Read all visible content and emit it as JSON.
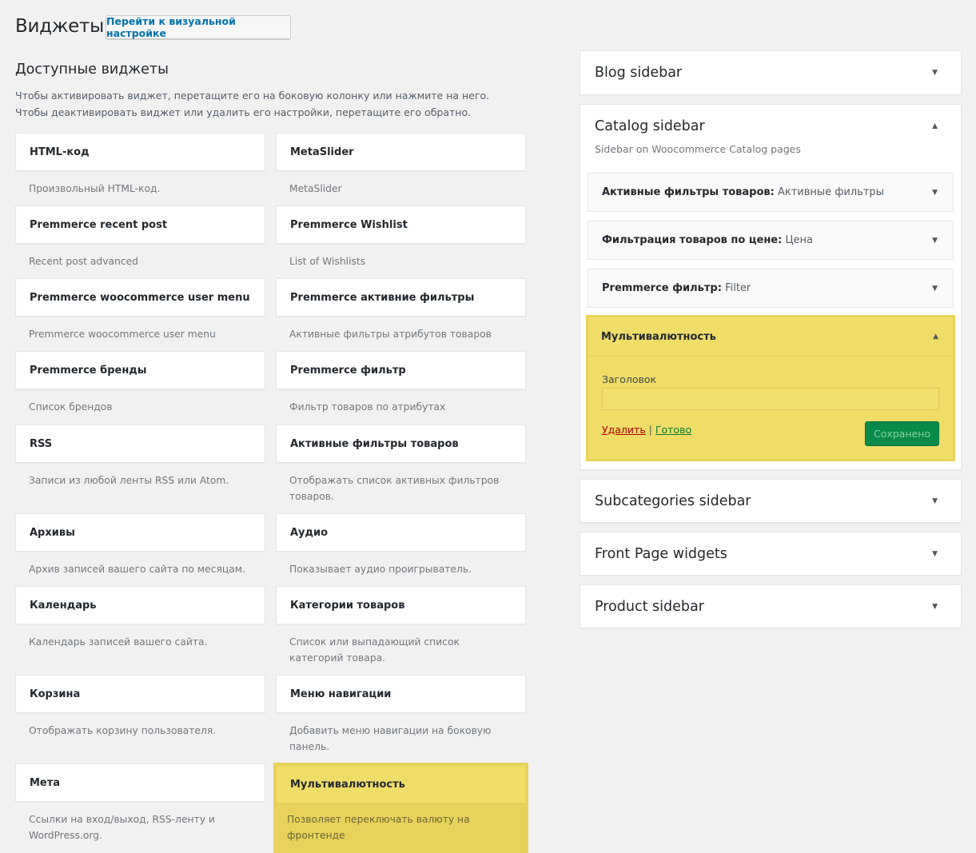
{
  "header": {
    "title": "Виджеты",
    "customize_label": "Перейти к визуальной настройке"
  },
  "available": {
    "title": "Доступные виджеты",
    "description": "Чтобы активировать виджет, перетащите его на боковую колонку или нажмите на него. Чтобы деактивировать виджет или удалить его настройки, перетащите его обратно.",
    "widgets": [
      {
        "title": "HTML-код",
        "desc": "Произвольный HTML-код."
      },
      {
        "title": "MetaSlider",
        "desc": "MetaSlider"
      },
      {
        "title": "Premmerce recent post",
        "desc": "Recent post advanced"
      },
      {
        "title": "Premmerce Wishlist",
        "desc": "List of Wishlists"
      },
      {
        "title": "Premmerce woocommerce user menu",
        "desc": "Premmerce woocommerce user menu"
      },
      {
        "title": "Premmerce активние фильтры",
        "desc": "Активные фильтры атрибутов товаров"
      },
      {
        "title": "Premmerce бренды",
        "desc": "Список брендов"
      },
      {
        "title": "Premmerce фильтр",
        "desc": "Фильтр товаров по атрибутах"
      },
      {
        "title": "RSS",
        "desc": "Записи из любой ленты RSS или Atom."
      },
      {
        "title": "Активные фильтры товаров",
        "desc": "Отображать список активных фильтров товаров."
      },
      {
        "title": "Архивы",
        "desc": "Архив записей вашего сайта по месяцам."
      },
      {
        "title": "Аудио",
        "desc": "Показывает аудио проигрыватель."
      },
      {
        "title": "Календарь",
        "desc": "Календарь записей вашего сайта."
      },
      {
        "title": "Категории товаров",
        "desc": "Список или выпадающий список категорий товара."
      },
      {
        "title": "Корзина",
        "desc": "Отображать корзину пользователя."
      },
      {
        "title": "Меню навигации",
        "desc": "Добавить меню навигации на боковую панель."
      },
      {
        "title": "Мета",
        "desc": "Ссылки на вход/выход, RSS-ленту и WordPress.org."
      },
      {
        "title": "Мультивалютность",
        "desc": "Позволяет переключать валюту на фронтенде"
      }
    ]
  },
  "sidebars": {
    "blog": {
      "title": "Blog sidebar"
    },
    "catalog": {
      "title": "Catalog sidebar",
      "description": "Sidebar on Woocommerce Catalog pages",
      "widgets": [
        {
          "title": "Активные фильтры товаров:",
          "sub": "Активные фильтры"
        },
        {
          "title": "Фильтрация товаров по цене:",
          "sub": "Цена"
        },
        {
          "title": "Premmerce фильтр:",
          "sub": "Filter"
        }
      ],
      "multi": {
        "title": "Мультивалютность",
        "field_label": "Заголовок",
        "field_value": "",
        "delete_label": "Удалить",
        "separator": "|",
        "done_label": "Готово",
        "saved_label": "Сохранено"
      }
    },
    "subcategories": {
      "title": "Subcategories sidebar"
    },
    "front": {
      "title": "Front Page widgets"
    },
    "product": {
      "title": "Product sidebar"
    }
  },
  "icons": {
    "collapsed": "arrow-down-icon",
    "expanded": "arrow-up-icon"
  },
  "colors": {
    "highlight": "#f0dd68",
    "link": "#0073aa",
    "saved_button": "#0a8a4a"
  }
}
